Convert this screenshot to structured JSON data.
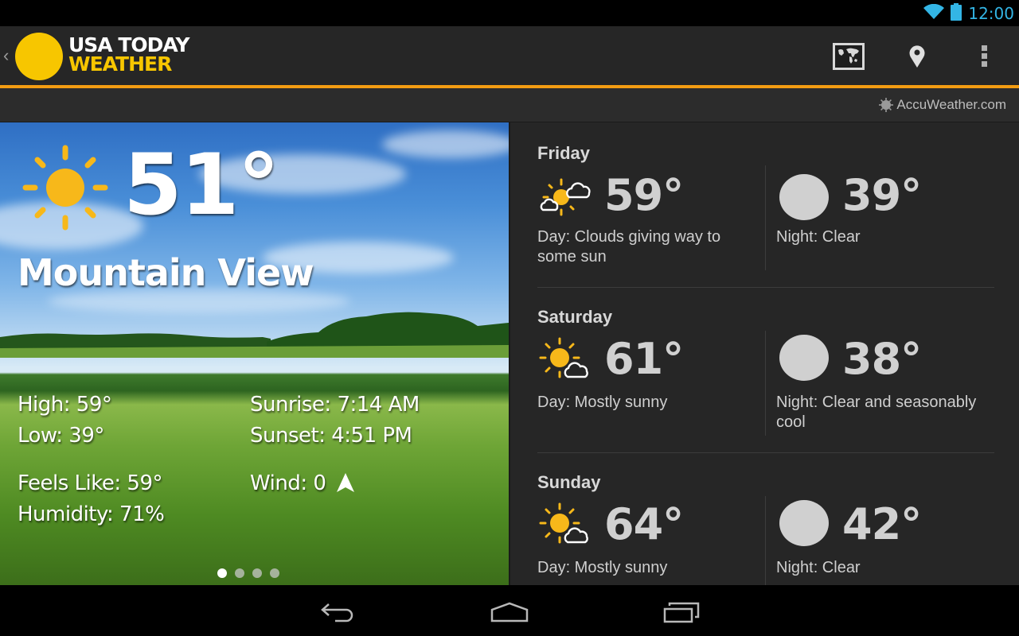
{
  "status_bar": {
    "time": "12:00",
    "icons": [
      "wifi-icon",
      "battery-icon"
    ],
    "accent_color": "#33b5e5"
  },
  "action_bar": {
    "back_icon": "chevron-left-icon",
    "logo": {
      "line1": "USA TODAY",
      "line2": "WEATHER",
      "brand_color": "#f7c600"
    },
    "actions": [
      {
        "name": "map",
        "icon": "world-map-icon"
      },
      {
        "name": "location",
        "icon": "location-pin-icon"
      },
      {
        "name": "overflow",
        "icon": "overflow-menu-icon"
      }
    ],
    "underline_color": "#f39c12"
  },
  "sub_bar": {
    "provider": "AccuWeather.com"
  },
  "current": {
    "condition_icon": "sunny-icon",
    "temperature": "51°",
    "city": "Mountain View",
    "high": "High: 59°",
    "low": "Low: 39°",
    "sunrise": "Sunrise: 7:14 AM",
    "sunset": "Sunset: 4:51 PM",
    "feels_like": "Feels Like: 59°",
    "humidity": "Humidity: 71%",
    "wind": "Wind: 0",
    "wind_icon": "wind-direction-arrow-icon",
    "page_indicator": {
      "total": 4,
      "active": 1
    }
  },
  "forecast": [
    {
      "day": "Friday",
      "day_icon": "sun-with-clouds-icon",
      "day_temp": "59°",
      "day_desc": "Day: Clouds giving way to some sun",
      "night_icon": "moon-icon",
      "night_temp": "39°",
      "night_desc": "Night: Clear"
    },
    {
      "day": "Saturday",
      "day_icon": "mostly-sunny-icon",
      "day_temp": "61°",
      "day_desc": "Day: Mostly sunny",
      "night_icon": "moon-icon",
      "night_temp": "38°",
      "night_desc": "Night: Clear and seasonably cool"
    },
    {
      "day": "Sunday",
      "day_icon": "mostly-sunny-icon",
      "day_temp": "64°",
      "day_desc": "Day: Mostly sunny",
      "night_icon": "moon-icon",
      "night_temp": "42°",
      "night_desc": "Night: Clear"
    }
  ],
  "nav_bar": {
    "buttons": [
      "back",
      "home",
      "recent-apps"
    ]
  }
}
